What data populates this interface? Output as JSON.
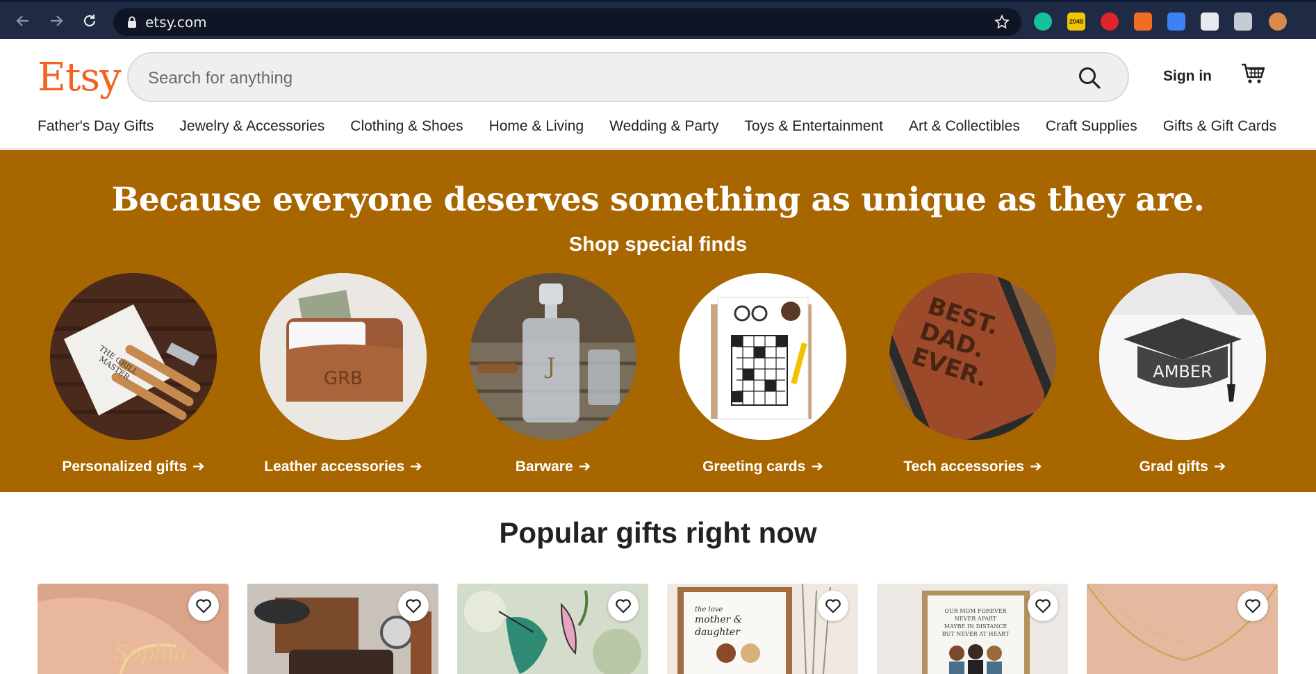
{
  "browser": {
    "url": "etsy.com",
    "extensions": [
      {
        "icon": "grammarly-icon",
        "color": "#15c39a"
      },
      {
        "icon": "2048-icon",
        "label": "2048",
        "color": "#f2c500"
      },
      {
        "icon": "adblock-icon",
        "color": "#e0242b"
      },
      {
        "icon": "honey-icon",
        "color": "#f26c22"
      },
      {
        "icon": "pen-icon",
        "color": "#3b82f6"
      },
      {
        "icon": "hand-icon",
        "color": "#e8eaed"
      },
      {
        "icon": "extensions-puzzle-icon",
        "color": "#c6cbd6"
      },
      {
        "icon": "profile-avatar-icon",
        "color": "#d98a4a"
      }
    ]
  },
  "header": {
    "logo": "Etsy",
    "search_placeholder": "Search for anything",
    "sign_in": "Sign in",
    "brand_color": "#f1641e"
  },
  "categories": [
    "Father's Day Gifts",
    "Jewelry & Accessories",
    "Clothing & Shoes",
    "Home & Living",
    "Wedding & Party",
    "Toys & Entertainment",
    "Art & Collectibles",
    "Craft Supplies",
    "Gifts & Gift Cards"
  ],
  "banner": {
    "headline": "Because everyone deserves something as unique as they are.",
    "subhead": "Shop special finds",
    "background": "#a86600",
    "finds": [
      {
        "label": "Personalized gifts",
        "icon": "bbq-tool-set-icon"
      },
      {
        "label": "Leather accessories",
        "icon": "leather-wallet-icon"
      },
      {
        "label": "Barware",
        "icon": "whiskey-decanter-icon"
      },
      {
        "label": "Greeting cards",
        "icon": "crossword-card-icon"
      },
      {
        "label": "Tech accessories",
        "icon": "wood-phone-case-icon"
      },
      {
        "label": "Grad gifts",
        "icon": "grad-cap-icon"
      }
    ],
    "wallet_text": "GRB",
    "phone_text": "BEST. DAD. EVER.",
    "grad_text": "AMBER"
  },
  "popular": {
    "title": "Popular gifts right now",
    "items": [
      {
        "icon": "name-ring-icon"
      },
      {
        "icon": "wallet-and-watch-icon"
      },
      {
        "icon": "hummingbird-suncatcher-icon"
      },
      {
        "icon": "mother-daughter-print-icon"
      },
      {
        "icon": "family-print-icon"
      },
      {
        "icon": "gold-necklace-icon"
      }
    ]
  }
}
